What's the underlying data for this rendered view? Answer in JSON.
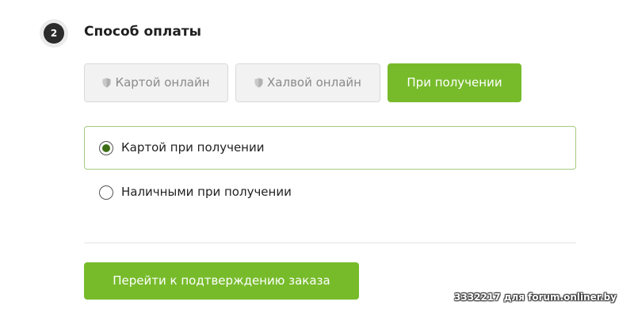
{
  "step": {
    "number": "2",
    "title": "Способ оплаты"
  },
  "payment_tabs": [
    {
      "label": "Картой онлайн",
      "icon": "shield-icon",
      "state": "disabled"
    },
    {
      "label": "Халвой онлайн",
      "icon": "shield-icon",
      "state": "disabled"
    },
    {
      "label": "При получении",
      "state": "active"
    }
  ],
  "options": [
    {
      "label": "Картой при получении",
      "selected": true
    },
    {
      "label": "Наличными при получении",
      "selected": false
    }
  ],
  "submit_button": {
    "label": "Перейти к подтверждению заказа"
  },
  "watermark": "3332217 для forum.onliner.by",
  "colors": {
    "accent": "#77bb2b",
    "disabled_bg": "#f2f2f2",
    "radio_dot": "#3d6f16"
  }
}
